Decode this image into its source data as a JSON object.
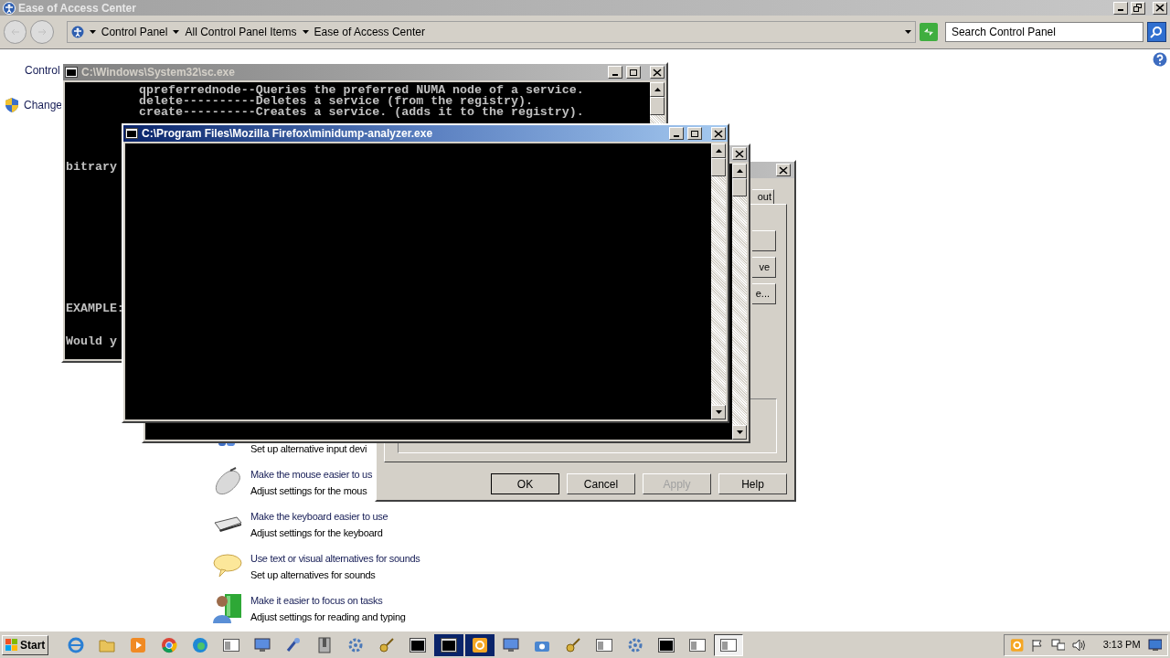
{
  "explorer": {
    "title": "Ease of Access Center",
    "breadcrumb": [
      "Control Panel",
      "All Control Panel Items",
      "Ease of Access Center"
    ],
    "search": {
      "placeholder": "Search Control Panel"
    },
    "sidebar": [
      {
        "kind": "text",
        "label": "Control"
      },
      {
        "kind": "shield",
        "label": "Change"
      }
    ],
    "items": [
      {
        "kind": "input",
        "description": "Set up alternative input devi"
      },
      {
        "kind": "mouse",
        "link": "Make the mouse easier to us",
        "description": "Adjust settings for the mous"
      },
      {
        "kind": "keyboard",
        "link": "Make the keyboard easier to use",
        "description": "Adjust settings for the keyboard"
      },
      {
        "kind": "speech",
        "link": "Use text or visual alternatives for sounds",
        "description": "Set up alternatives for sounds"
      },
      {
        "kind": "focus",
        "link": "Make it easier to focus on tasks",
        "description": "Adjust settings for reading and typing"
      }
    ]
  },
  "dialog": {
    "tab": "out",
    "side_buttons": [
      "ve",
      "e..."
    ],
    "buttons": [
      {
        "label": "OK",
        "disabled": false
      },
      {
        "label": "Cancel",
        "disabled": false
      },
      {
        "label": "Apply",
        "disabled": true
      },
      {
        "label": "Help",
        "disabled": false
      }
    ]
  },
  "sc_console": {
    "title": "C:\\Windows\\System32\\sc.exe",
    "lines": [
      "qpreferrednode--Queries the preferred NUMA node of a service.",
      "delete----------Deletes a service (from the registry).",
      "create----------Creates a service. (adds it to the registry).",
      "bitrary",
      "EXAMPLE:",
      "Would y"
    ]
  },
  "minidump_console": {
    "title": "C:\\Program Files\\Mozilla Firefox\\minidump-analyzer.exe"
  },
  "taskbar": {
    "start": "Start",
    "buttons": [
      {
        "kind": "ie",
        "selected": false,
        "flashing": false
      },
      {
        "kind": "folder",
        "selected": false,
        "flashing": false
      },
      {
        "kind": "media",
        "selected": false,
        "flashing": false
      },
      {
        "kind": "chrome",
        "selected": false,
        "flashing": false
      },
      {
        "kind": "edge",
        "selected": false,
        "flashing": false
      },
      {
        "kind": "window",
        "selected": false,
        "flashing": false
      },
      {
        "kind": "monitor",
        "selected": false,
        "flashing": false
      },
      {
        "kind": "tool",
        "selected": false,
        "flashing": false
      },
      {
        "kind": "archive",
        "selected": false,
        "flashing": false
      },
      {
        "kind": "gear",
        "selected": false,
        "flashing": false
      },
      {
        "kind": "key",
        "selected": false,
        "flashing": false
      },
      {
        "kind": "terminal",
        "selected": false,
        "flashing": false
      },
      {
        "kind": "terminal",
        "selected": false,
        "flashing": true
      },
      {
        "kind": "office",
        "selected": false,
        "flashing": true
      },
      {
        "kind": "monitor",
        "selected": false,
        "flashing": false
      },
      {
        "kind": "camera",
        "selected": false,
        "flashing": false
      },
      {
        "kind": "key",
        "selected": false,
        "flashing": false
      },
      {
        "kind": "window",
        "selected": false,
        "flashing": false
      },
      {
        "kind": "gear",
        "selected": false,
        "flashing": false
      },
      {
        "kind": "terminal",
        "selected": false,
        "flashing": false
      },
      {
        "kind": "window",
        "selected": false,
        "flashing": false
      },
      {
        "kind": "window",
        "selected": true,
        "flashing": false
      }
    ],
    "time": "3:13 PM"
  }
}
